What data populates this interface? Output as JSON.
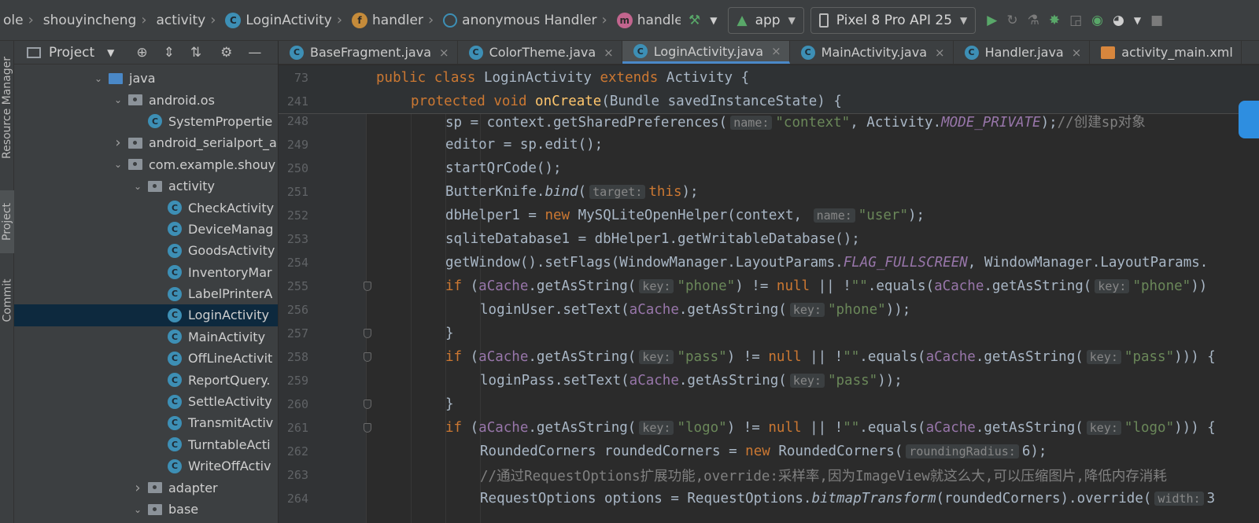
{
  "breadcrumbs": [
    {
      "label": "ole",
      "icon": ""
    },
    {
      "label": "shouyincheng",
      "icon": ""
    },
    {
      "label": "activity",
      "icon": ""
    },
    {
      "label": "LoginActivity",
      "icon": "class-icon"
    },
    {
      "label": "handler",
      "icon": "field-icon"
    },
    {
      "label": "anonymous Handler",
      "icon": "anonymous-class-icon"
    },
    {
      "label": "handleMessage",
      "icon": "method-icon"
    }
  ],
  "toolbar": {
    "run_config": "app",
    "device": "Pixel 8 Pro API 25"
  },
  "side_tabs": {
    "resource_manager": "Resource Manager",
    "project": "Project",
    "commit": "Commit"
  },
  "project_panel": {
    "title": "Project",
    "tree": [
      {
        "label": "java",
        "kind": "folder-blue",
        "depth": 0,
        "arrow": "down"
      },
      {
        "label": "android.os",
        "kind": "package",
        "depth": 1,
        "arrow": "down"
      },
      {
        "label": "SystemPropertie",
        "kind": "class",
        "depth": 2,
        "arrow": ""
      },
      {
        "label": "android_serialport_a",
        "kind": "package",
        "depth": 1,
        "arrow": "right"
      },
      {
        "label": "com.example.shouy",
        "kind": "package",
        "depth": 1,
        "arrow": "down"
      },
      {
        "label": "activity",
        "kind": "package",
        "depth": 2,
        "arrow": "down"
      },
      {
        "label": "CheckActivity",
        "kind": "class",
        "depth": 3,
        "arrow": ""
      },
      {
        "label": "DeviceManag",
        "kind": "class",
        "depth": 3,
        "arrow": ""
      },
      {
        "label": "GoodsActivity",
        "kind": "class",
        "depth": 3,
        "arrow": ""
      },
      {
        "label": "InventoryMar",
        "kind": "class",
        "depth": 3,
        "arrow": ""
      },
      {
        "label": "LabelPrinterA",
        "kind": "class",
        "depth": 3,
        "arrow": ""
      },
      {
        "label": "LoginActivity",
        "kind": "class",
        "depth": 3,
        "arrow": "",
        "selected": true
      },
      {
        "label": "MainActivity",
        "kind": "class",
        "depth": 3,
        "arrow": ""
      },
      {
        "label": "OffLineActivit",
        "kind": "class",
        "depth": 3,
        "arrow": ""
      },
      {
        "label": "ReportQuery.",
        "kind": "class",
        "depth": 3,
        "arrow": ""
      },
      {
        "label": "SettleActivity",
        "kind": "class",
        "depth": 3,
        "arrow": ""
      },
      {
        "label": "TransmitActiv",
        "kind": "class",
        "depth": 3,
        "arrow": ""
      },
      {
        "label": "TurntableActi",
        "kind": "class",
        "depth": 3,
        "arrow": ""
      },
      {
        "label": "WriteOffActiv",
        "kind": "class",
        "depth": 3,
        "arrow": ""
      },
      {
        "label": "adapter",
        "kind": "package",
        "depth": 2,
        "arrow": "right"
      },
      {
        "label": "base",
        "kind": "package",
        "depth": 2,
        "arrow": "down"
      }
    ]
  },
  "tabs": [
    {
      "label": "BaseFragment.java",
      "active": false,
      "icon": "class-icon"
    },
    {
      "label": "ColorTheme.java",
      "active": false,
      "icon": "class-icon"
    },
    {
      "label": "LoginActivity.java",
      "active": true,
      "icon": "class-icon"
    },
    {
      "label": "MainActivity.java",
      "active": false,
      "icon": "class-icon"
    },
    {
      "label": "Handler.java",
      "active": false,
      "icon": "class-icon"
    },
    {
      "label": "activity_main.xml",
      "active": false,
      "icon": "xml-icon"
    }
  ],
  "editor": {
    "sticky": [
      {
        "num": "73",
        "indent": 0,
        "tokens": [
          [
            "kw",
            "public class "
          ],
          [
            "",
            "LoginActivity "
          ],
          [
            "kw",
            "extends "
          ],
          [
            "",
            "Activity {"
          ]
        ]
      },
      {
        "num": "241",
        "indent": 1,
        "tokens": [
          [
            "kw",
            "protected void "
          ],
          [
            "fn",
            "onCreate"
          ],
          [
            "",
            "(Bundle savedInstanceState) {"
          ]
        ]
      }
    ],
    "lines": [
      {
        "num": "248",
        "indent": 2,
        "tokens": [
          [
            "",
            "sp = context.getSharedPreferences("
          ],
          [
            "hint",
            "name:"
          ],
          [
            "str",
            "\"context\""
          ],
          [
            "",
            ", Activity."
          ],
          [
            "fld ital",
            "MODE_PRIVATE"
          ],
          [
            "",
            ");"
          ],
          [
            "cmt",
            "//创建sp对象"
          ]
        ]
      },
      {
        "num": "249",
        "indent": 2,
        "tokens": [
          [
            "",
            "editor = sp.edit();"
          ]
        ]
      },
      {
        "num": "250",
        "indent": 2,
        "tokens": [
          [
            "",
            "startQrCode();"
          ]
        ]
      },
      {
        "num": "251",
        "indent": 2,
        "tokens": [
          [
            "",
            "ButterKnife."
          ],
          [
            "ital",
            "bind"
          ],
          [
            "",
            "("
          ],
          [
            "hint",
            "target:"
          ],
          [
            "kw",
            "this"
          ],
          [
            "",
            ");"
          ]
        ]
      },
      {
        "num": "252",
        "indent": 2,
        "tokens": [
          [
            "",
            "dbHelper1 = "
          ],
          [
            "kw",
            "new "
          ],
          [
            "",
            "MySQLiteOpenHelper(context, "
          ],
          [
            "hint",
            "name:"
          ],
          [
            "str",
            "\"user\""
          ],
          [
            "",
            ");"
          ]
        ]
      },
      {
        "num": "253",
        "indent": 2,
        "tokens": [
          [
            "",
            "sqliteDatabase1 = dbHelper1.getWritableDatabase();"
          ]
        ]
      },
      {
        "num": "254",
        "indent": 2,
        "tokens": [
          [
            "",
            "getWindow().setFlags(WindowManager.LayoutParams."
          ],
          [
            "fld ital",
            "FLAG_FULLSCREEN"
          ],
          [
            "",
            ", WindowManager.LayoutParams."
          ]
        ]
      },
      {
        "num": "255",
        "indent": 2,
        "fold": true,
        "tokens": [
          [
            "kw",
            "if "
          ],
          [
            "",
            "("
          ],
          [
            "fld",
            "aCache"
          ],
          [
            "",
            ".getAsString("
          ],
          [
            "hint",
            "key:"
          ],
          [
            "str",
            "\"phone\""
          ],
          [
            "",
            ") != "
          ],
          [
            "kw",
            "null "
          ],
          [
            "",
            "|| !"
          ],
          [
            "str",
            "\"\""
          ],
          [
            "",
            ".equals("
          ],
          [
            "fld",
            "aCache"
          ],
          [
            "",
            ".getAsString("
          ],
          [
            "hint",
            "key:"
          ],
          [
            "str",
            "\"phone\""
          ],
          [
            "",
            "))"
          ]
        ]
      },
      {
        "num": "256",
        "indent": 3,
        "tokens": [
          [
            "",
            "loginUser.setText("
          ],
          [
            "fld",
            "aCache"
          ],
          [
            "",
            ".getAsString("
          ],
          [
            "hint",
            "key:"
          ],
          [
            "str",
            "\"phone\""
          ],
          [
            "",
            "));"
          ]
        ]
      },
      {
        "num": "257",
        "indent": 2,
        "fold": true,
        "tokens": [
          [
            "",
            "}"
          ]
        ]
      },
      {
        "num": "258",
        "indent": 2,
        "fold": true,
        "tokens": [
          [
            "kw",
            "if "
          ],
          [
            "",
            "("
          ],
          [
            "fld",
            "aCache"
          ],
          [
            "",
            ".getAsString("
          ],
          [
            "hint",
            "key:"
          ],
          [
            "str",
            "\"pass\""
          ],
          [
            "",
            ") != "
          ],
          [
            "kw",
            "null "
          ],
          [
            "",
            "|| !"
          ],
          [
            "str",
            "\"\""
          ],
          [
            "",
            ".equals("
          ],
          [
            "fld",
            "aCache"
          ],
          [
            "",
            ".getAsString("
          ],
          [
            "hint",
            "key:"
          ],
          [
            "str",
            "\"pass\""
          ],
          [
            "",
            "))) {"
          ]
        ]
      },
      {
        "num": "259",
        "indent": 3,
        "tokens": [
          [
            "",
            "loginPass.setText("
          ],
          [
            "fld",
            "aCache"
          ],
          [
            "",
            ".getAsString("
          ],
          [
            "hint",
            "key:"
          ],
          [
            "str",
            "\"pass\""
          ],
          [
            "",
            "));"
          ]
        ]
      },
      {
        "num": "260",
        "indent": 2,
        "fold": true,
        "tokens": [
          [
            "",
            "}"
          ]
        ]
      },
      {
        "num": "261",
        "indent": 2,
        "fold": true,
        "tokens": [
          [
            "kw",
            "if "
          ],
          [
            "",
            "("
          ],
          [
            "fld",
            "aCache"
          ],
          [
            "",
            ".getAsString("
          ],
          [
            "hint",
            "key:"
          ],
          [
            "str",
            "\"logo\""
          ],
          [
            "",
            ") != "
          ],
          [
            "kw",
            "null "
          ],
          [
            "",
            "|| !"
          ],
          [
            "str",
            "\"\""
          ],
          [
            "",
            ".equals("
          ],
          [
            "fld",
            "aCache"
          ],
          [
            "",
            ".getAsString("
          ],
          [
            "hint",
            "key:"
          ],
          [
            "str",
            "\"logo\""
          ],
          [
            "",
            "))) {"
          ]
        ]
      },
      {
        "num": "262",
        "indent": 3,
        "tokens": [
          [
            "",
            "RoundedCorners roundedCorners = "
          ],
          [
            "kw",
            "new "
          ],
          [
            "",
            "RoundedCorners("
          ],
          [
            "hint",
            "roundingRadius:"
          ],
          [
            "",
            "6);"
          ]
        ]
      },
      {
        "num": "263",
        "indent": 3,
        "tokens": [
          [
            "cmt",
            "//通过RequestOptions扩展功能,override:采样率,因为ImageView就这么大,可以压缩图片,降低内存消耗"
          ]
        ]
      },
      {
        "num": "264",
        "indent": 3,
        "tokens": [
          [
            "",
            "RequestOptions options = RequestOptions."
          ],
          [
            "ital",
            "bitmapTransform"
          ],
          [
            "",
            "(roundedCorners).override("
          ],
          [
            "hint",
            "width:"
          ],
          [
            "",
            "3"
          ]
        ]
      }
    ]
  },
  "colors": {
    "bg": "#2b2b2b",
    "panel": "#3c3f41",
    "keyword": "#cc7832",
    "string": "#6a8759",
    "method": "#ffc66d",
    "field": "#9876aa",
    "selection": "#0d293e",
    "accent": "#4a88c7"
  }
}
